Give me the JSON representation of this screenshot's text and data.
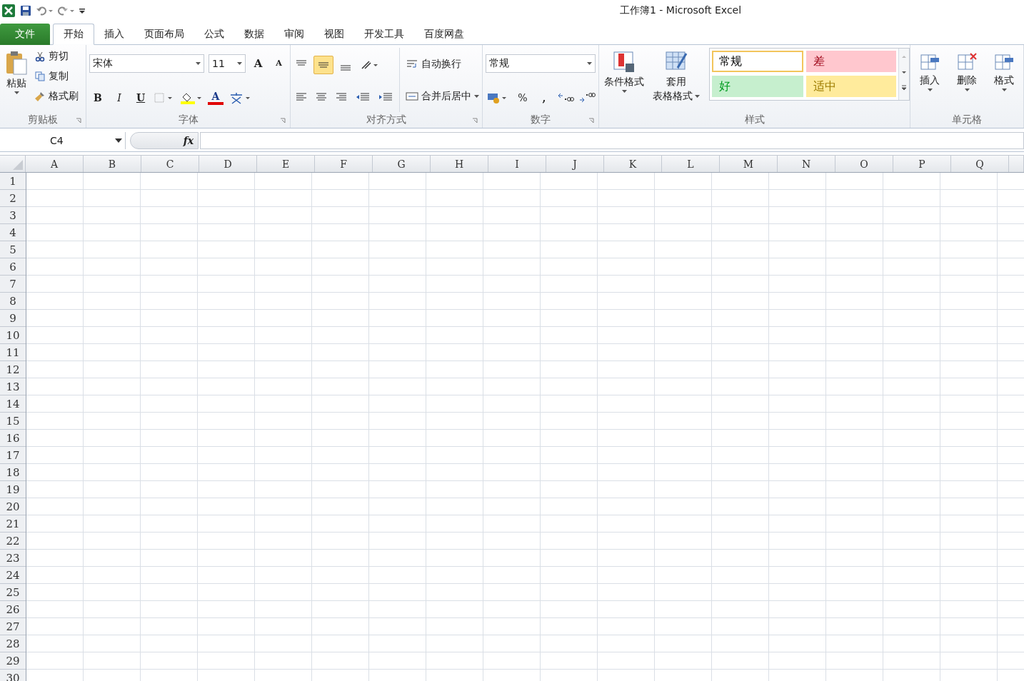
{
  "window": {
    "title": "工作簿1 - Microsoft Excel"
  },
  "tabs": [
    {
      "label": "文件",
      "kind": "file",
      "selected": false
    },
    {
      "label": "开始",
      "kind": "tab",
      "selected": true
    },
    {
      "label": "插入",
      "kind": "tab",
      "selected": false
    },
    {
      "label": "页面布局",
      "kind": "tab",
      "selected": false
    },
    {
      "label": "公式",
      "kind": "tab",
      "selected": false
    },
    {
      "label": "数据",
      "kind": "tab",
      "selected": false
    },
    {
      "label": "审阅",
      "kind": "tab",
      "selected": false
    },
    {
      "label": "视图",
      "kind": "tab",
      "selected": false
    },
    {
      "label": "开发工具",
      "kind": "tab",
      "selected": false
    },
    {
      "label": "百度网盘",
      "kind": "tab",
      "selected": false
    }
  ],
  "ribbon": {
    "clipboard": {
      "label": "剪贴板",
      "paste": "粘贴",
      "items": [
        "剪切",
        "复制",
        "格式刷"
      ]
    },
    "font": {
      "label": "字体",
      "font_name": "宋体",
      "font_size": "11",
      "grow": "A",
      "shrink": "A",
      "bold": "B",
      "italic": "I",
      "underline": "U",
      "font_color": "A"
    },
    "alignment": {
      "label": "对齐方式",
      "center_selected": true,
      "wrap": "自动换行",
      "merge": "合并后居中"
    },
    "number": {
      "label": "数字",
      "format": "常规",
      "percent": "%",
      "comma": ","
    },
    "styles": {
      "label": "样式",
      "conditional": "条件格式",
      "table_format": [
        "套用",
        "表格格式"
      ],
      "cell_styles": [
        {
          "label": "常规",
          "color": "#ffffff",
          "selected": true
        },
        {
          "label": "差",
          "color": "#ffc7ce",
          "selected": false
        },
        {
          "label": "好",
          "color": "#c6efce",
          "selected": false
        },
        {
          "label": "适中",
          "color": "#ffeb9c",
          "selected": false
        }
      ]
    },
    "cells": {
      "label": "单元格",
      "buttons": [
        "插入",
        "删除",
        "格式"
      ]
    }
  },
  "formula_bar": {
    "name_box": "C4",
    "function_label": "fx"
  },
  "sheet": {
    "columns": [
      "A",
      "B",
      "C",
      "D",
      "E",
      "F",
      "G",
      "H",
      "I",
      "J",
      "K",
      "L",
      "M",
      "N",
      "O",
      "P",
      "Q"
    ],
    "rows": [
      "1",
      "2",
      "3",
      "4",
      "5",
      "6",
      "7",
      "8",
      "9",
      "10",
      "11",
      "12",
      "13",
      "14",
      "15",
      "16",
      "17",
      "18",
      "19",
      "20",
      "21",
      "22",
      "23",
      "24",
      "25",
      "26",
      "27",
      "28",
      "29",
      "30"
    ]
  }
}
